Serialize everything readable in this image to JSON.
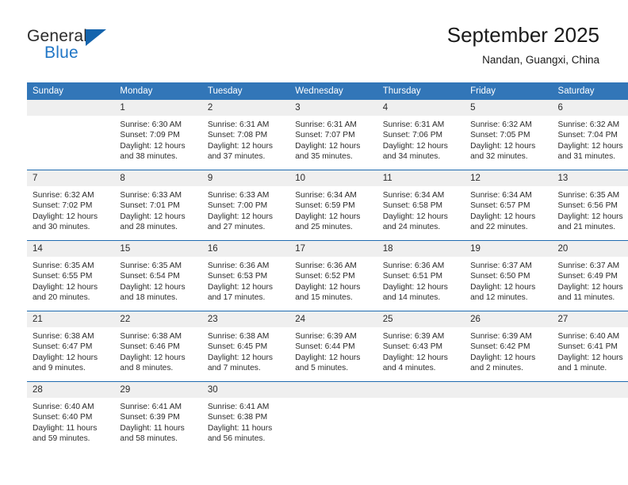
{
  "brand": {
    "name_top": "General",
    "name_bottom": "Blue",
    "accent_color": "#2076c6",
    "triangle_color": "#1464ad"
  },
  "header": {
    "title": "September 2025",
    "subtitle": "Nandan, Guangxi, China"
  },
  "theme": {
    "header_row_bg": "#3276b8",
    "daynum_bg": "#efefef",
    "row_separator": "#1f6bb0"
  },
  "weekday_headers": [
    "Sunday",
    "Monday",
    "Tuesday",
    "Wednesday",
    "Thursday",
    "Friday",
    "Saturday"
  ],
  "weeks": [
    [
      {
        "day": "",
        "sunrise": "",
        "sunset": "",
        "daylight1": "",
        "daylight2": ""
      },
      {
        "day": "1",
        "sunrise": "Sunrise: 6:30 AM",
        "sunset": "Sunset: 7:09 PM",
        "daylight1": "Daylight: 12 hours",
        "daylight2": "and 38 minutes."
      },
      {
        "day": "2",
        "sunrise": "Sunrise: 6:31 AM",
        "sunset": "Sunset: 7:08 PM",
        "daylight1": "Daylight: 12 hours",
        "daylight2": "and 37 minutes."
      },
      {
        "day": "3",
        "sunrise": "Sunrise: 6:31 AM",
        "sunset": "Sunset: 7:07 PM",
        "daylight1": "Daylight: 12 hours",
        "daylight2": "and 35 minutes."
      },
      {
        "day": "4",
        "sunrise": "Sunrise: 6:31 AM",
        "sunset": "Sunset: 7:06 PM",
        "daylight1": "Daylight: 12 hours",
        "daylight2": "and 34 minutes."
      },
      {
        "day": "5",
        "sunrise": "Sunrise: 6:32 AM",
        "sunset": "Sunset: 7:05 PM",
        "daylight1": "Daylight: 12 hours",
        "daylight2": "and 32 minutes."
      },
      {
        "day": "6",
        "sunrise": "Sunrise: 6:32 AM",
        "sunset": "Sunset: 7:04 PM",
        "daylight1": "Daylight: 12 hours",
        "daylight2": "and 31 minutes."
      }
    ],
    [
      {
        "day": "7",
        "sunrise": "Sunrise: 6:32 AM",
        "sunset": "Sunset: 7:02 PM",
        "daylight1": "Daylight: 12 hours",
        "daylight2": "and 30 minutes."
      },
      {
        "day": "8",
        "sunrise": "Sunrise: 6:33 AM",
        "sunset": "Sunset: 7:01 PM",
        "daylight1": "Daylight: 12 hours",
        "daylight2": "and 28 minutes."
      },
      {
        "day": "9",
        "sunrise": "Sunrise: 6:33 AM",
        "sunset": "Sunset: 7:00 PM",
        "daylight1": "Daylight: 12 hours",
        "daylight2": "and 27 minutes."
      },
      {
        "day": "10",
        "sunrise": "Sunrise: 6:34 AM",
        "sunset": "Sunset: 6:59 PM",
        "daylight1": "Daylight: 12 hours",
        "daylight2": "and 25 minutes."
      },
      {
        "day": "11",
        "sunrise": "Sunrise: 6:34 AM",
        "sunset": "Sunset: 6:58 PM",
        "daylight1": "Daylight: 12 hours",
        "daylight2": "and 24 minutes."
      },
      {
        "day": "12",
        "sunrise": "Sunrise: 6:34 AM",
        "sunset": "Sunset: 6:57 PM",
        "daylight1": "Daylight: 12 hours",
        "daylight2": "and 22 minutes."
      },
      {
        "day": "13",
        "sunrise": "Sunrise: 6:35 AM",
        "sunset": "Sunset: 6:56 PM",
        "daylight1": "Daylight: 12 hours",
        "daylight2": "and 21 minutes."
      }
    ],
    [
      {
        "day": "14",
        "sunrise": "Sunrise: 6:35 AM",
        "sunset": "Sunset: 6:55 PM",
        "daylight1": "Daylight: 12 hours",
        "daylight2": "and 20 minutes."
      },
      {
        "day": "15",
        "sunrise": "Sunrise: 6:35 AM",
        "sunset": "Sunset: 6:54 PM",
        "daylight1": "Daylight: 12 hours",
        "daylight2": "and 18 minutes."
      },
      {
        "day": "16",
        "sunrise": "Sunrise: 6:36 AM",
        "sunset": "Sunset: 6:53 PM",
        "daylight1": "Daylight: 12 hours",
        "daylight2": "and 17 minutes."
      },
      {
        "day": "17",
        "sunrise": "Sunrise: 6:36 AM",
        "sunset": "Sunset: 6:52 PM",
        "daylight1": "Daylight: 12 hours",
        "daylight2": "and 15 minutes."
      },
      {
        "day": "18",
        "sunrise": "Sunrise: 6:36 AM",
        "sunset": "Sunset: 6:51 PM",
        "daylight1": "Daylight: 12 hours",
        "daylight2": "and 14 minutes."
      },
      {
        "day": "19",
        "sunrise": "Sunrise: 6:37 AM",
        "sunset": "Sunset: 6:50 PM",
        "daylight1": "Daylight: 12 hours",
        "daylight2": "and 12 minutes."
      },
      {
        "day": "20",
        "sunrise": "Sunrise: 6:37 AM",
        "sunset": "Sunset: 6:49 PM",
        "daylight1": "Daylight: 12 hours",
        "daylight2": "and 11 minutes."
      }
    ],
    [
      {
        "day": "21",
        "sunrise": "Sunrise: 6:38 AM",
        "sunset": "Sunset: 6:47 PM",
        "daylight1": "Daylight: 12 hours",
        "daylight2": "and 9 minutes."
      },
      {
        "day": "22",
        "sunrise": "Sunrise: 6:38 AM",
        "sunset": "Sunset: 6:46 PM",
        "daylight1": "Daylight: 12 hours",
        "daylight2": "and 8 minutes."
      },
      {
        "day": "23",
        "sunrise": "Sunrise: 6:38 AM",
        "sunset": "Sunset: 6:45 PM",
        "daylight1": "Daylight: 12 hours",
        "daylight2": "and 7 minutes."
      },
      {
        "day": "24",
        "sunrise": "Sunrise: 6:39 AM",
        "sunset": "Sunset: 6:44 PM",
        "daylight1": "Daylight: 12 hours",
        "daylight2": "and 5 minutes."
      },
      {
        "day": "25",
        "sunrise": "Sunrise: 6:39 AM",
        "sunset": "Sunset: 6:43 PM",
        "daylight1": "Daylight: 12 hours",
        "daylight2": "and 4 minutes."
      },
      {
        "day": "26",
        "sunrise": "Sunrise: 6:39 AM",
        "sunset": "Sunset: 6:42 PM",
        "daylight1": "Daylight: 12 hours",
        "daylight2": "and 2 minutes."
      },
      {
        "day": "27",
        "sunrise": "Sunrise: 6:40 AM",
        "sunset": "Sunset: 6:41 PM",
        "daylight1": "Daylight: 12 hours",
        "daylight2": "and 1 minute."
      }
    ],
    [
      {
        "day": "28",
        "sunrise": "Sunrise: 6:40 AM",
        "sunset": "Sunset: 6:40 PM",
        "daylight1": "Daylight: 11 hours",
        "daylight2": "and 59 minutes."
      },
      {
        "day": "29",
        "sunrise": "Sunrise: 6:41 AM",
        "sunset": "Sunset: 6:39 PM",
        "daylight1": "Daylight: 11 hours",
        "daylight2": "and 58 minutes."
      },
      {
        "day": "30",
        "sunrise": "Sunrise: 6:41 AM",
        "sunset": "Sunset: 6:38 PM",
        "daylight1": "Daylight: 11 hours",
        "daylight2": "and 56 minutes."
      },
      {
        "day": "",
        "sunrise": "",
        "sunset": "",
        "daylight1": "",
        "daylight2": ""
      },
      {
        "day": "",
        "sunrise": "",
        "sunset": "",
        "daylight1": "",
        "daylight2": ""
      },
      {
        "day": "",
        "sunrise": "",
        "sunset": "",
        "daylight1": "",
        "daylight2": ""
      },
      {
        "day": "",
        "sunrise": "",
        "sunset": "",
        "daylight1": "",
        "daylight2": ""
      }
    ]
  ]
}
